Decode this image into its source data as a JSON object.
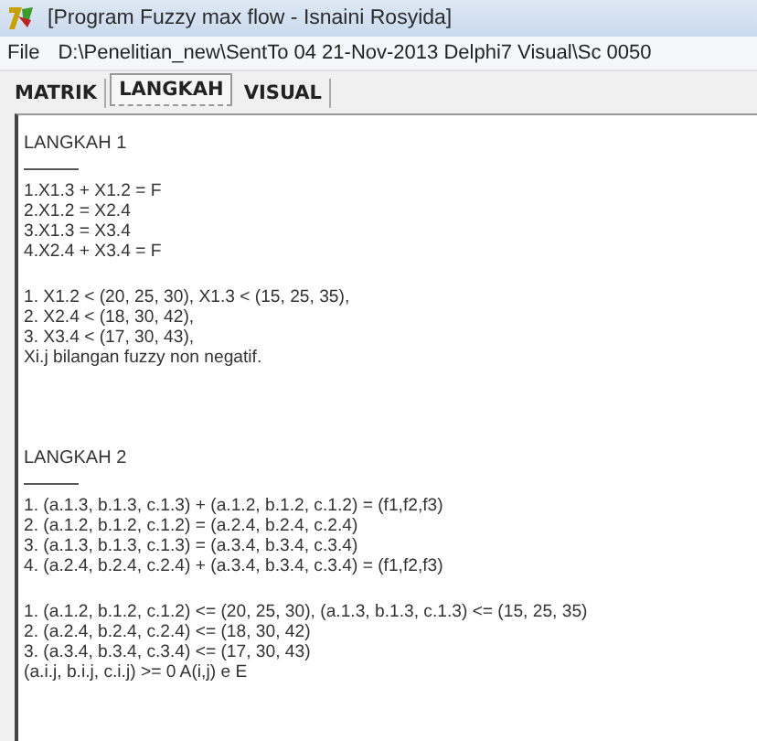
{
  "window": {
    "title": "[Program Fuzzy max flow - Isnaini Rosyida]"
  },
  "menu": [
    {
      "label": "File"
    },
    {
      "label": "D:\\Penelitian_new\\SentTo 04 21-Nov-2013 Delphi7 Visual\\Sc 0050"
    }
  ],
  "tabs": [
    {
      "label": "MATRIK",
      "selected": false
    },
    {
      "label": "LANGKAH",
      "selected": true
    },
    {
      "label": "VISUAL",
      "selected": false
    }
  ],
  "memo": {
    "sections": [
      {
        "heading": "LANGKAH 1",
        "groups": [
          [
            "1.X1.3 + X1.2 = F",
            "2.X1.2 = X2.4",
            "3.X1.3 = X3.4",
            "4.X2.4 + X3.4 = F"
          ],
          [
            "1. X1.2 < (20, 25, 30),  X1.3 < (15, 25, 35),",
            "2. X2.4 < (18, 30, 42),",
            "3. X3.4 < (17, 30, 43),",
            "Xi.j bilangan fuzzy non negatif."
          ]
        ]
      },
      {
        "heading": "LANGKAH 2",
        "groups": [
          [
            "1. (a.1.3, b.1.3, c.1.3) + (a.1.2, b.1.2, c.1.2) = (f1,f2,f3)",
            "2. (a.1.2, b.1.2, c.1.2) = (a.2.4, b.2.4, c.2.4)",
            "3. (a.1.3, b.1.3, c.1.3) = (a.3.4, b.3.4, c.3.4)",
            "4. (a.2.4, b.2.4, c.2.4) + (a.3.4, b.3.4, c.3.4) = (f1,f2,f3)"
          ],
          [
            "1.  (a.1.2, b.1.2, c.1.2) <= (20, 25, 30),  (a.1.3, b.1.3, c.1.3) <= (15, 25, 35)",
            "2.  (a.2.4, b.2.4, c.2.4) <= (18, 30, 42)",
            "3.  (a.3.4, b.3.4, c.3.4) <= (17, 30, 43)",
            "(a.i.j, b.i.j, c.i.j) >= 0   A(i,j) e E"
          ]
        ]
      }
    ]
  }
}
